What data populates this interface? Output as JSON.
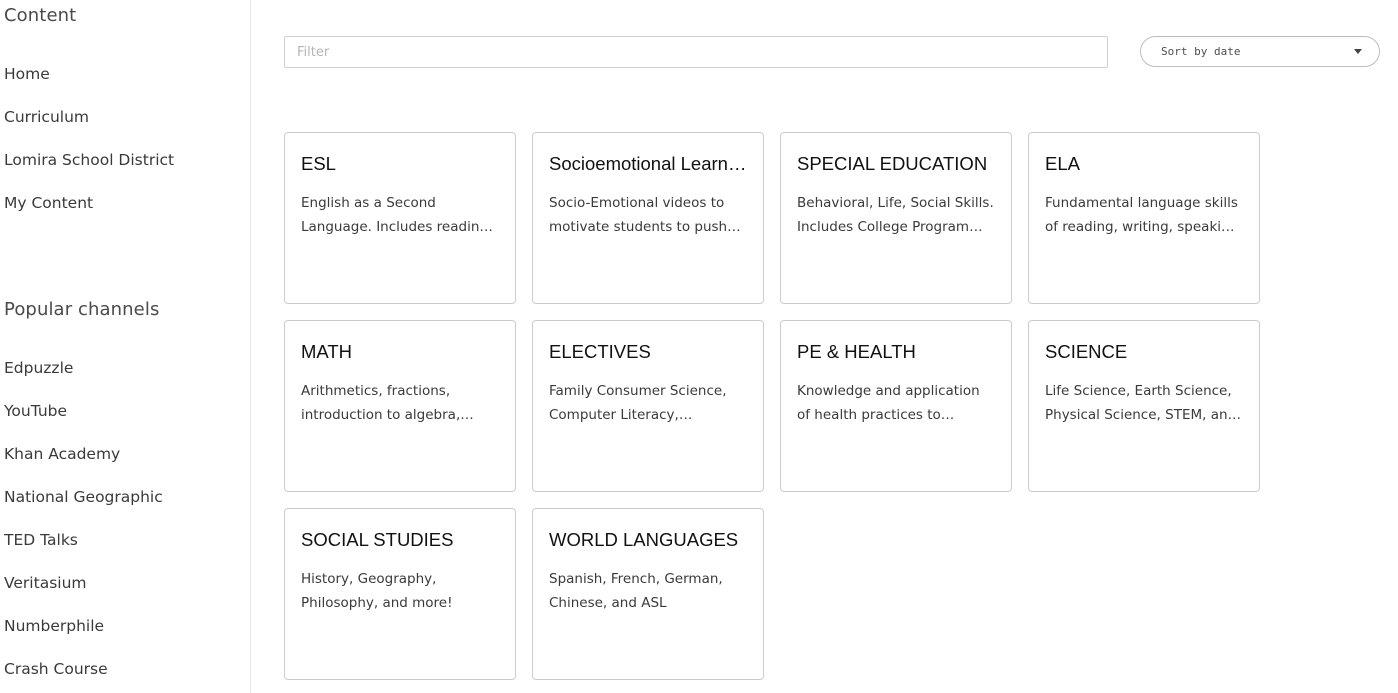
{
  "sidebar": {
    "content_heading": "Content",
    "main_items": [
      {
        "label": "Home"
      },
      {
        "label": "Curriculum"
      },
      {
        "label": "Lomira School District"
      },
      {
        "label": "My Content"
      }
    ],
    "popular_heading": "Popular channels",
    "channels": [
      {
        "label": "Edpuzzle"
      },
      {
        "label": "YouTube"
      },
      {
        "label": "Khan Academy"
      },
      {
        "label": "National Geographic"
      },
      {
        "label": "TED Talks"
      },
      {
        "label": "Veritasium"
      },
      {
        "label": "Numberphile"
      },
      {
        "label": "Crash Course"
      }
    ]
  },
  "toolbar": {
    "filter_placeholder": "Filter",
    "filter_value": "",
    "sort_label": "Sort by date",
    "sort_icon": "chevron-down-icon"
  },
  "cards": [
    {
      "title": "ESL",
      "desc": "English as a Second Language. Includes reading, writing, listening and speaking."
    },
    {
      "title": "Socioemotional Learning",
      "desc": "Socio-Emotional videos to motivate students to push themselves."
    },
    {
      "title": "SPECIAL EDUCATION",
      "desc": "Behavioral, Life, Social Skills. Includes College Program resources."
    },
    {
      "title": "ELA",
      "desc": "Fundamental language skills of reading, writing, speaking and listening."
    },
    {
      "title": "MATH",
      "desc": "Arithmetics, fractions, introduction to algebra, geometry and more."
    },
    {
      "title": "ELECTIVES",
      "desc": "Family Consumer Science, Computer Literacy, Computer Science and more."
    },
    {
      "title": "PE & HEALTH",
      "desc": "Knowledge and application of health practices to develop healthy habits."
    },
    {
      "title": "SCIENCE",
      "desc": "Life Science, Earth Science, Physical Science, STEM, and more."
    },
    {
      "title": "SOCIAL STUDIES",
      "desc": "History, Geography, Philosophy, and more!"
    },
    {
      "title": "WORLD LANGUAGES",
      "desc": "Spanish, French, German, Chinese, and ASL"
    }
  ]
}
